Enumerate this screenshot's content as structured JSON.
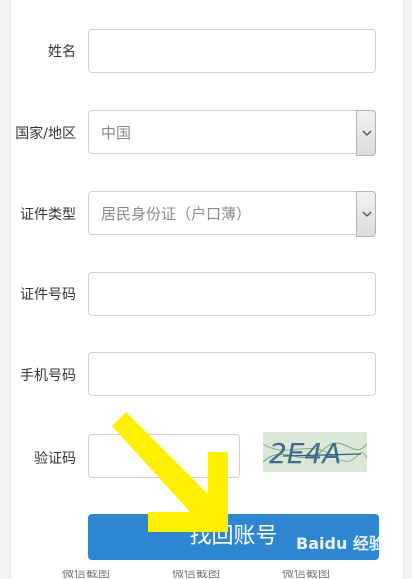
{
  "form": {
    "name_label": "姓名",
    "name_value": "",
    "country_label": "国家/地区",
    "country_value": "中国",
    "id_type_label": "证件类型",
    "id_type_value": "居民身份证（户口薄）",
    "id_number_label": "证件号码",
    "id_number_value": "",
    "phone_label": "手机号码",
    "phone_value": "",
    "captcha_label": "验证码",
    "captcha_value": "",
    "captcha_image_text": "2E4A"
  },
  "submit_label": "找回账号",
  "bottom_tabs": [
    "微信截图",
    "微信截图",
    "微信截图"
  ],
  "watermark": {
    "brand": "Bai",
    "paw": "du",
    "site": "经验"
  },
  "colors": {
    "primary_button": "#2e86d1",
    "arrow": "#ffef00"
  }
}
